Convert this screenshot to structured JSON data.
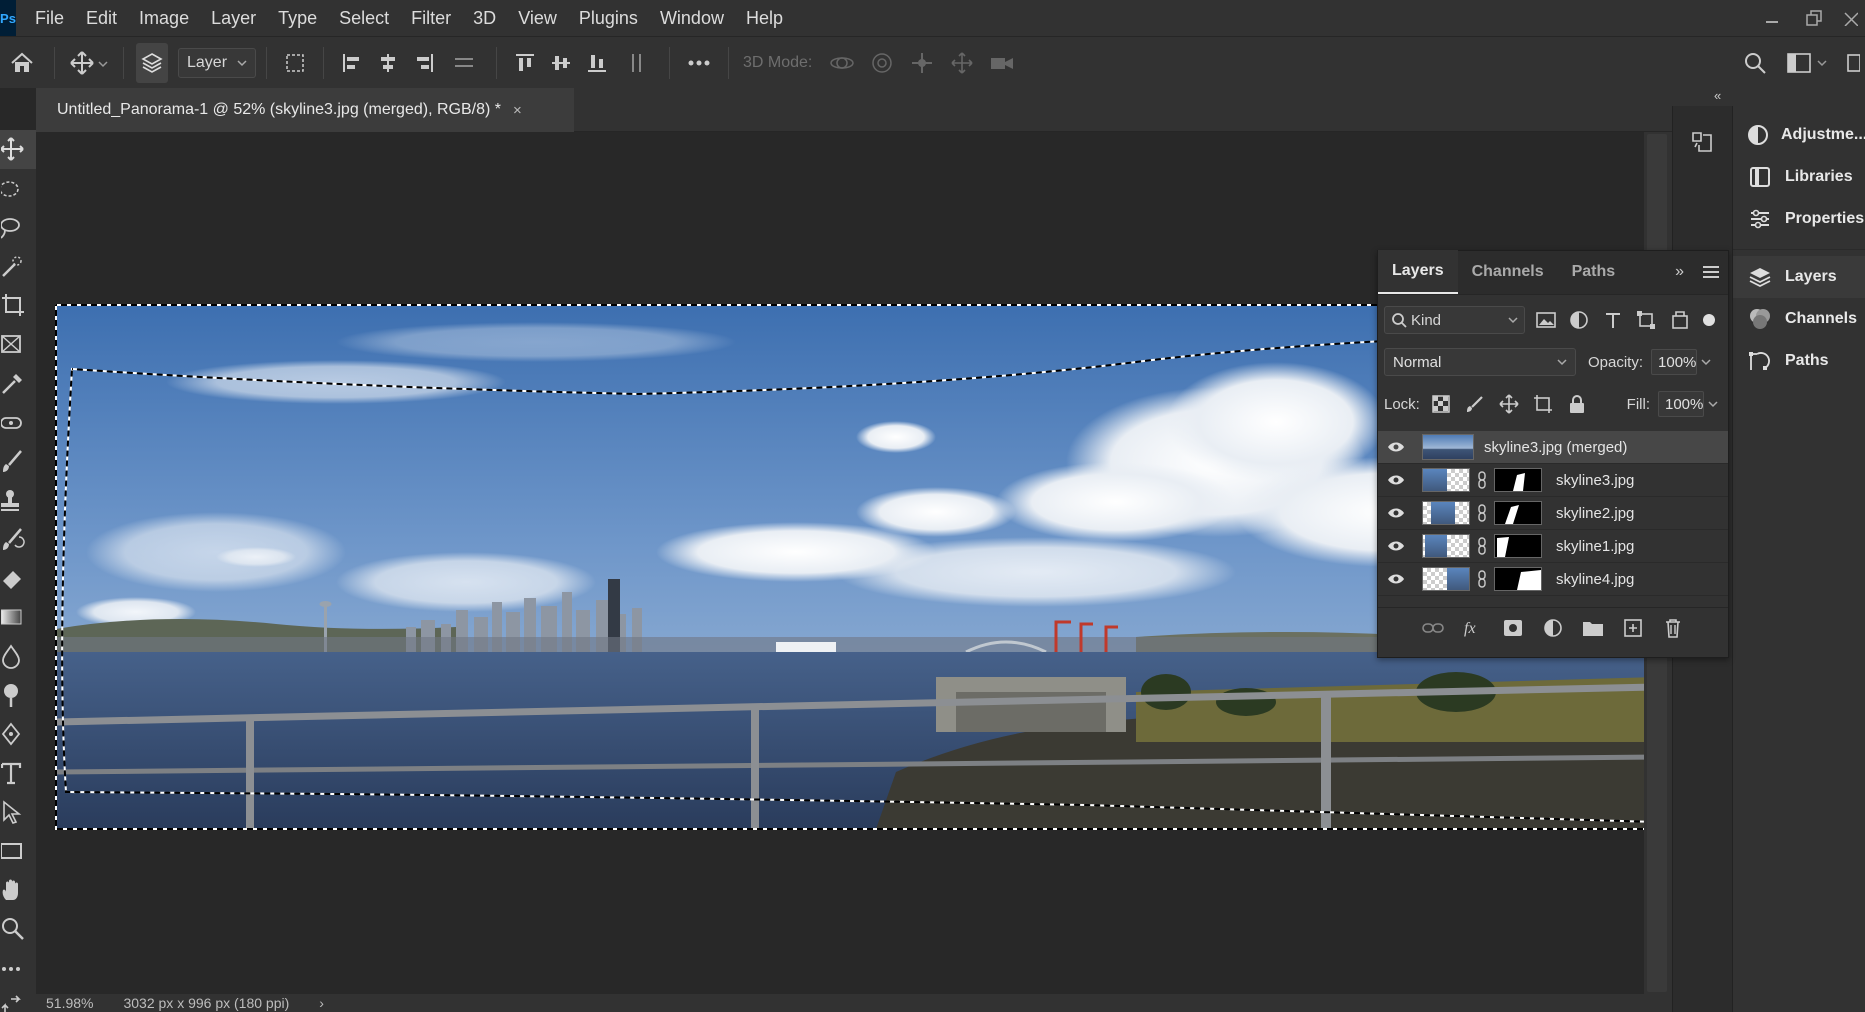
{
  "app": {
    "logo_text": "Ps"
  },
  "menu": [
    "File",
    "Edit",
    "Image",
    "Layer",
    "Type",
    "Select",
    "Filter",
    "3D",
    "View",
    "Plugins",
    "Window",
    "Help"
  ],
  "options": {
    "layer_select": "Layer",
    "mode3d_label": "3D Mode:"
  },
  "document": {
    "tab_title": "Untitled_Panorama-1 @ 52% (skyline3.jpg (merged), RGB/8) *",
    "close_glyph": "×"
  },
  "status": {
    "zoom": "51.98%",
    "dimensions": "3032 px x 996 px (180 ppi)",
    "arrow": "›"
  },
  "dock": {
    "adjustments": "Adjustme...",
    "libraries": "Libraries",
    "properties": "Properties",
    "layers": "Layers",
    "channels": "Channels",
    "paths": "Paths",
    "collapse_glyph": "«"
  },
  "layers_panel": {
    "tabs": [
      "Layers",
      "Channels",
      "Paths"
    ],
    "more_glyph": "»",
    "kind_label": "Kind",
    "blend_mode": "Normal",
    "opacity_label": "Opacity:",
    "opacity_value": "100%",
    "lock_label": "Lock:",
    "fill_label": "Fill:",
    "fill_value": "100%",
    "layers": [
      {
        "name": "skyline3.jpg (merged)",
        "selected": true
      },
      {
        "name": "skyline3.jpg",
        "selected": false
      },
      {
        "name": "skyline2.jpg",
        "selected": false
      },
      {
        "name": "skyline1.jpg",
        "selected": false
      },
      {
        "name": "skyline4.jpg",
        "selected": false
      }
    ]
  },
  "colors": {
    "ui_bg": "#323232",
    "canvas_bg": "#282828",
    "accent_logo": "#31a8ff"
  }
}
